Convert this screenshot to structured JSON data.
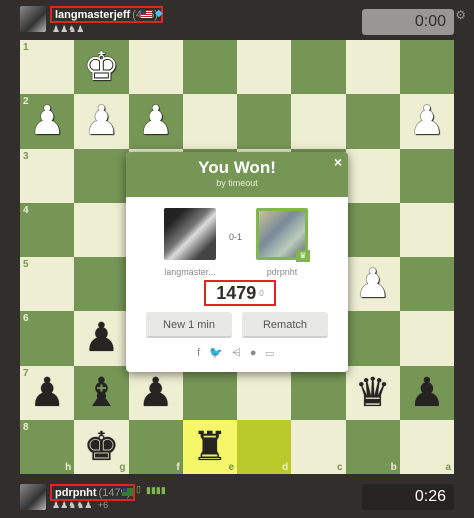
{
  "top_player": {
    "name": "langmasterjeff",
    "rating": "(495)",
    "captured": "♟♟♞♟",
    "clock": "0:00"
  },
  "bottom_player": {
    "name": "pdrpnht",
    "rating": "(1479)",
    "captured": "♟♟♞♞♟",
    "extra": "+6",
    "bars": "▮▮▮▮",
    "clock": "0:26"
  },
  "board": {
    "ranks": [
      "1",
      "2",
      "3",
      "4",
      "5",
      "6",
      "7",
      "8"
    ],
    "files": [
      "h",
      "g",
      "f",
      "e",
      "d",
      "c",
      "b",
      "a"
    ],
    "squares": [
      [
        "",
        "wK",
        "",
        "",
        "",
        "",
        "",
        ""
      ],
      [
        "wP",
        "wP",
        "wP",
        "",
        "",
        "",
        "",
        "wP"
      ],
      [
        "",
        "",
        "",
        "",
        "",
        "",
        "",
        ""
      ],
      [
        "",
        "",
        "",
        "",
        "",
        "",
        "",
        ""
      ],
      [
        "",
        "",
        "",
        "",
        "",
        "",
        "wP",
        ""
      ],
      [
        "",
        "bP",
        "",
        "",
        "",
        "",
        "",
        ""
      ],
      [
        "bP",
        "bB",
        "bP",
        "",
        "",
        "",
        "bQ",
        "bP"
      ],
      [
        "",
        "bK",
        "",
        "bR",
        "",
        "",
        "",
        ""
      ]
    ],
    "highlight": [
      [
        7,
        3
      ],
      [
        7,
        4
      ]
    ],
    "colors": {
      "light": "#eeeed2",
      "dark": "#769656",
      "hl_light": "#f6f669",
      "hl_dark": "#baca2b"
    }
  },
  "modal": {
    "title": "You Won!",
    "subtitle": "by timeout",
    "close": "×",
    "score": "0-1",
    "left_name": "langmaster...",
    "right_name": "pdrpnht",
    "rating": "1479",
    "rating_delta": "0",
    "btn_new": "New 1 min",
    "btn_rematch": "Rematch",
    "share": "f 🐦 ⩤ ● ▭"
  }
}
